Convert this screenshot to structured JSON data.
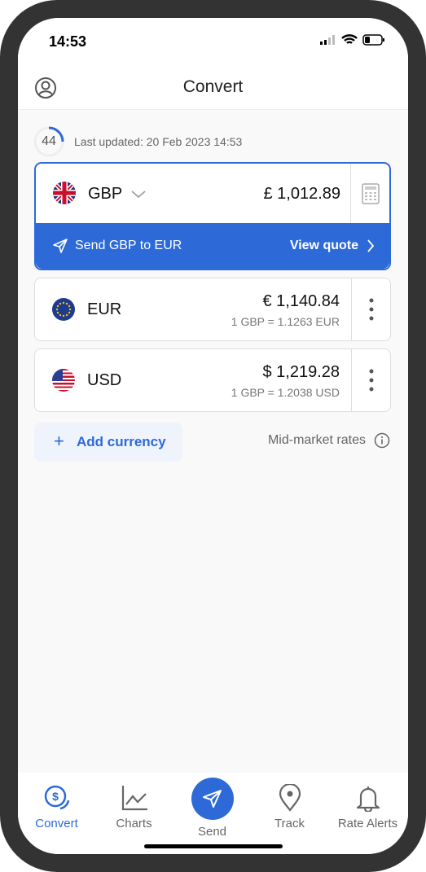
{
  "status": {
    "time": "14:53"
  },
  "header": {
    "title": "Convert"
  },
  "refresh": {
    "countdown": "44",
    "last_updated": "Last updated: 20 Feb 2023 14:53"
  },
  "base": {
    "code": "GBP",
    "amount": "£ 1,012.89",
    "send_label": "Send GBP to EUR",
    "quote_label": "View quote"
  },
  "currencies": [
    {
      "code": "EUR",
      "amount": "€ 1,140.84",
      "rate": "1 GBP = 1.1263 EUR"
    },
    {
      "code": "USD",
      "amount": "$ 1,219.28",
      "rate": "1 GBP = 1.2038 USD"
    }
  ],
  "add_currency": "Add currency",
  "mid_market": "Mid-market rates",
  "nav": [
    {
      "label": "Convert"
    },
    {
      "label": "Charts"
    },
    {
      "label": "Send"
    },
    {
      "label": "Track"
    },
    {
      "label": "Rate Alerts"
    }
  ],
  "colors": {
    "accent": "#2d6ad8"
  }
}
